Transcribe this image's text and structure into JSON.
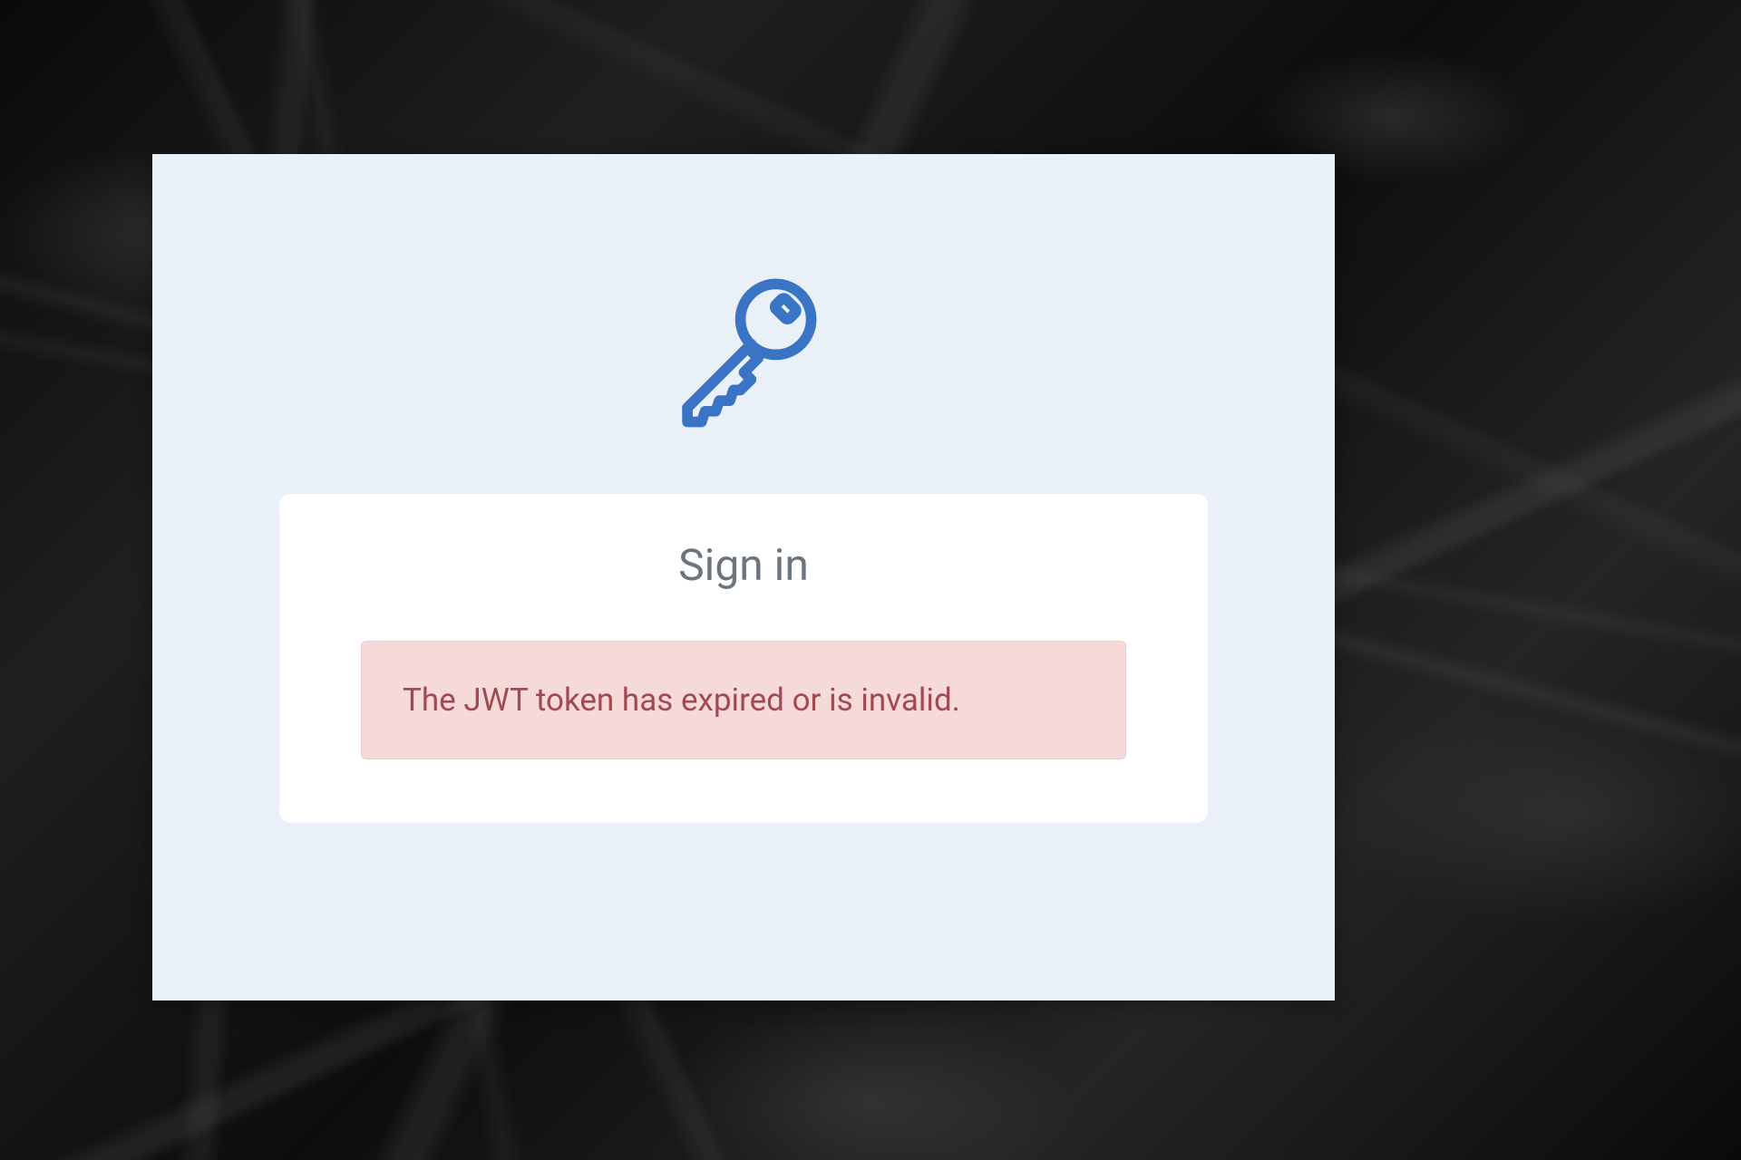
{
  "card": {
    "title": "Sign in"
  },
  "alert": {
    "message": "The JWT token has expired or is invalid."
  },
  "icon": {
    "name": "key-icon",
    "stroke_color": "#3a74c4"
  }
}
